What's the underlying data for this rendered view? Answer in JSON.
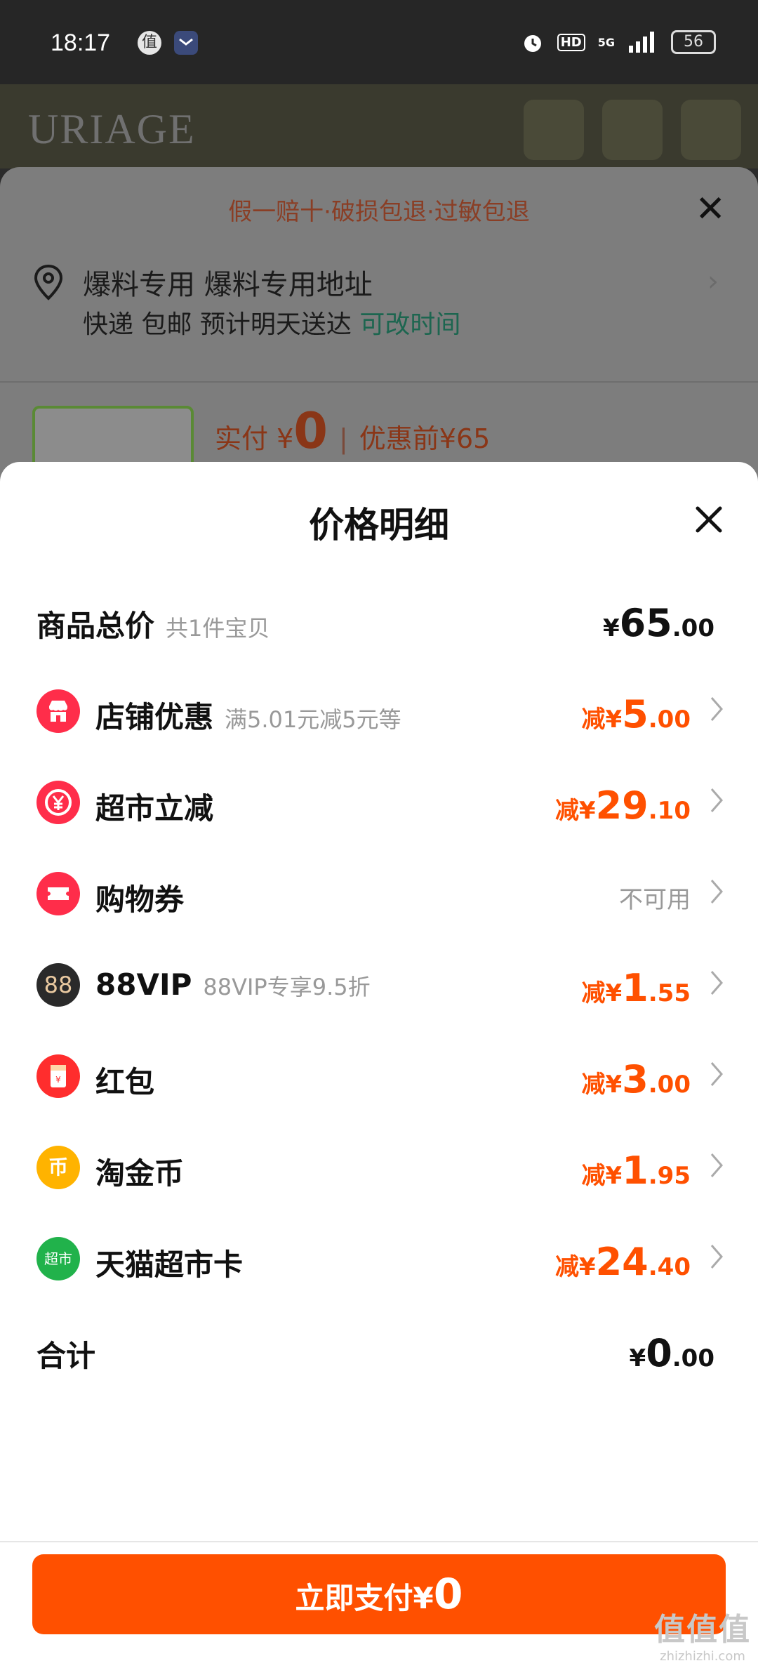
{
  "status_bar": {
    "time": "18:17",
    "app1_glyph": "值",
    "network": "5G",
    "hd": "HD",
    "battery": "56"
  },
  "background": {
    "brand_logo": "URIAGE",
    "banner": "假一赔十·破损包退·过敏包退",
    "address_line": "爆料专用 爆料专用地址",
    "delivery_text": "快递 包邮 预计明天送达",
    "delivery_link": "可改时间",
    "paid_label": "实付 ¥",
    "paid_amount": "0",
    "before_discount": "优惠前¥65"
  },
  "sheet": {
    "title": "价格明细",
    "total_row": {
      "label": "商品总价",
      "sub": "共1件宝贝",
      "currency": "¥",
      "int": "65",
      "dec": ".00"
    },
    "discounts": [
      {
        "icon": "store-icon",
        "label": "店铺优惠",
        "sub": "满5.01元减5元等",
        "prefix": "减¥",
        "int": "5",
        "dec": ".00",
        "color": "#ff2d4a"
      },
      {
        "icon": "yuan-coin-icon",
        "label": "超市立减",
        "sub": "",
        "prefix": "减¥",
        "int": "29",
        "dec": ".10",
        "color": "#ff2d4a"
      },
      {
        "icon": "ticket-icon",
        "label": "购物券",
        "sub": "",
        "unavailable": "不可用",
        "color": "#ff2d4a"
      },
      {
        "icon": "88vip-icon",
        "label": "88VIP",
        "sub": "88VIP专享9.5折",
        "prefix": "减¥",
        "int": "1",
        "dec": ".55",
        "color": "#2a2a2a",
        "glyph": "88"
      },
      {
        "icon": "red-packet-icon",
        "label": "红包",
        "sub": "",
        "prefix": "减¥",
        "int": "3",
        "dec": ".00",
        "color": "#ff2d2d"
      },
      {
        "icon": "gold-coin-icon",
        "label": "淘金币",
        "sub": "",
        "prefix": "减¥",
        "int": "1",
        "dec": ".95",
        "color": "#ffb300",
        "glyph": "币"
      },
      {
        "icon": "supermarket-card-icon",
        "label": "天猫超市卡",
        "sub": "",
        "prefix": "减¥",
        "int": "24",
        "dec": ".40",
        "color": "#21b24b",
        "glyph": "超市"
      }
    ],
    "sum_row": {
      "label": "合计",
      "currency": "¥",
      "int": "0",
      "dec": ".00"
    },
    "pay_button": {
      "label": "立即支付",
      "currency": "¥",
      "amount": "0"
    }
  },
  "watermark": {
    "big": "值值值",
    "small": "zhizhizhi.com"
  },
  "colors": {
    "accent": "#ff5000",
    "discount_text": "#ff5000",
    "muted": "#999999"
  }
}
